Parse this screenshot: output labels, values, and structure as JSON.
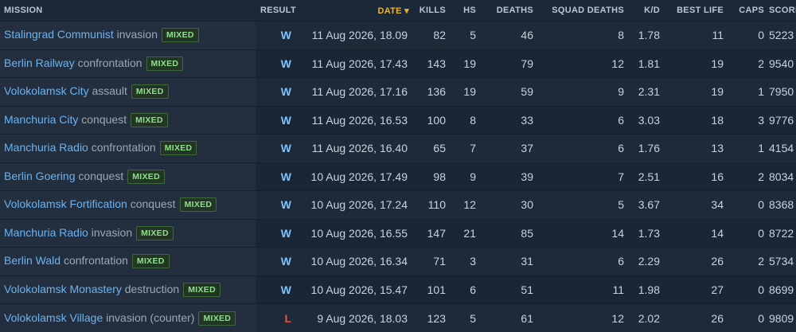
{
  "headers": {
    "mission": "MISSION",
    "result": "RESULT",
    "date": "DATE ▾",
    "kills": "KILLS",
    "hs": "HS",
    "deaths": "DEATHS",
    "squad_deaths": "SQUAD DEATHS",
    "kd": "K/D",
    "best_life": "BEST LIFE",
    "caps": "CAPS",
    "score": "SCORE"
  },
  "colors": {
    "win": "#7cc4ff",
    "loss": "#e0584a",
    "sorted_header": "#f0b429",
    "location_link": "#6ab3f2",
    "badge": "#8fe08a"
  },
  "rows": [
    {
      "location": "Stalingrad Communist",
      "type": "invasion",
      "badge": "MIXED",
      "result": "W",
      "date": "11 Aug 2026, 18.09",
      "kills": "82",
      "hs": "5",
      "deaths": "46",
      "squad_deaths": "8",
      "kd": "1.78",
      "best_life": "11",
      "caps": "0",
      "score": "5223"
    },
    {
      "location": "Berlin Railway",
      "type": "confrontation",
      "badge": "MIXED",
      "result": "W",
      "date": "11 Aug 2026, 17.43",
      "kills": "143",
      "hs": "19",
      "deaths": "79",
      "squad_deaths": "12",
      "kd": "1.81",
      "best_life": "19",
      "caps": "2",
      "score": "9540"
    },
    {
      "location": "Volokolamsk City",
      "type": "assault",
      "badge": "MIXED",
      "result": "W",
      "date": "11 Aug 2026, 17.16",
      "kills": "136",
      "hs": "19",
      "deaths": "59",
      "squad_deaths": "9",
      "kd": "2.31",
      "best_life": "19",
      "caps": "1",
      "score": "7950"
    },
    {
      "location": "Manchuria City",
      "type": "conquest",
      "badge": "MIXED",
      "result": "W",
      "date": "11 Aug 2026, 16.53",
      "kills": "100",
      "hs": "8",
      "deaths": "33",
      "squad_deaths": "6",
      "kd": "3.03",
      "best_life": "18",
      "caps": "3",
      "score": "9776"
    },
    {
      "location": "Manchuria Radio",
      "type": "confrontation",
      "badge": "MIXED",
      "result": "W",
      "date": "11 Aug 2026, 16.40",
      "kills": "65",
      "hs": "7",
      "deaths": "37",
      "squad_deaths": "6",
      "kd": "1.76",
      "best_life": "13",
      "caps": "1",
      "score": "4154"
    },
    {
      "location": "Berlin Goering",
      "type": "conquest",
      "badge": "MIXED",
      "result": "W",
      "date": "10 Aug 2026, 17.49",
      "kills": "98",
      "hs": "9",
      "deaths": "39",
      "squad_deaths": "7",
      "kd": "2.51",
      "best_life": "16",
      "caps": "2",
      "score": "8034"
    },
    {
      "location": "Volokolamsk Fortification",
      "type": "conquest",
      "badge": "MIXED",
      "result": "W",
      "date": "10 Aug 2026, 17.24",
      "kills": "110",
      "hs": "12",
      "deaths": "30",
      "squad_deaths": "5",
      "kd": "3.67",
      "best_life": "34",
      "caps": "0",
      "score": "8368"
    },
    {
      "location": "Manchuria Radio",
      "type": "invasion",
      "badge": "MIXED",
      "result": "W",
      "date": "10 Aug 2026, 16.55",
      "kills": "147",
      "hs": "21",
      "deaths": "85",
      "squad_deaths": "14",
      "kd": "1.73",
      "best_life": "14",
      "caps": "0",
      "score": "8722"
    },
    {
      "location": "Berlin Wald",
      "type": "confrontation",
      "badge": "MIXED",
      "result": "W",
      "date": "10 Aug 2026, 16.34",
      "kills": "71",
      "hs": "3",
      "deaths": "31",
      "squad_deaths": "6",
      "kd": "2.29",
      "best_life": "26",
      "caps": "2",
      "score": "5734"
    },
    {
      "location": "Volokolamsk Monastery",
      "type": "destruction",
      "badge": "MIXED",
      "result": "W",
      "date": "10 Aug 2026, 15.47",
      "kills": "101",
      "hs": "6",
      "deaths": "51",
      "squad_deaths": "11",
      "kd": "1.98",
      "best_life": "27",
      "caps": "0",
      "score": "8699"
    },
    {
      "location": "Volokolamsk Village",
      "type": "invasion (counter)",
      "badge": "MIXED",
      "result": "L",
      "date": "9 Aug 2026, 18.03",
      "kills": "123",
      "hs": "5",
      "deaths": "61",
      "squad_deaths": "12",
      "kd": "2.02",
      "best_life": "26",
      "caps": "0",
      "score": "9809"
    }
  ]
}
